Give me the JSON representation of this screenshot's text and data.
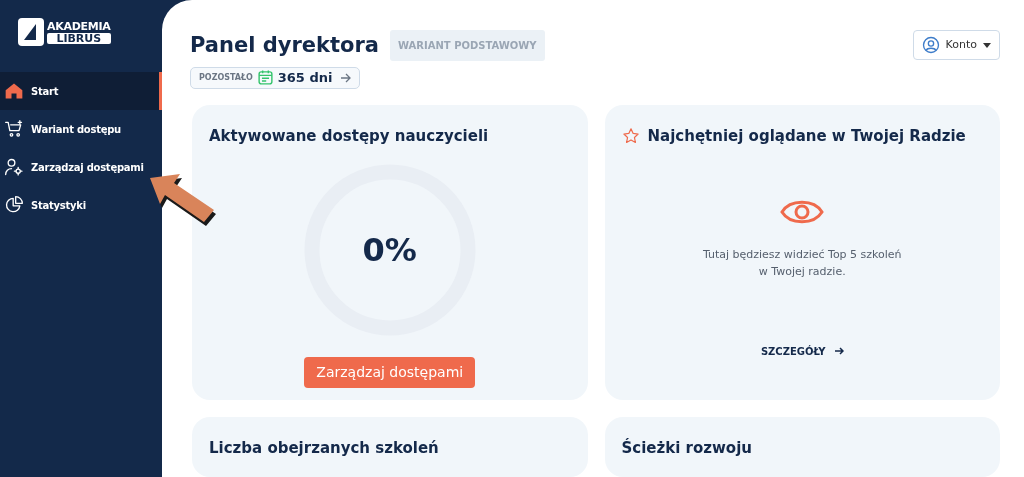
{
  "logo": {
    "line_1": "AKADEMIA",
    "line_2": "LIBRUS"
  },
  "sidebar": {
    "items": [
      {
        "label": "Start",
        "selected": true
      },
      {
        "label": "Wariant dostępu",
        "selected": false
      },
      {
        "label": "Zarządzaj dostępami",
        "selected": false
      },
      {
        "label": "Statystyki",
        "selected": false
      }
    ]
  },
  "header": {
    "title": "Panel dyrektora",
    "badge": "WARIANT PODSTAWOWY",
    "account_button": "Konto"
  },
  "remaining": {
    "label": "POZOSTAŁO",
    "value": "365 dni"
  },
  "cards": [
    {
      "kind": "gauge",
      "title": "Aktywowane dostępy nauczycieli",
      "value": "0%",
      "button": "Zarządzaj dostępami"
    },
    {
      "kind": "empty",
      "title": "Najchętniej oglądane w Twojej Radzie",
      "message": "Tutaj będziesz widzieć Top 5 szkoleń w Twojej radzie.",
      "link": "SZCZEGÓŁY"
    },
    {
      "kind": "plain",
      "title": "Liczba obejrzanych szkoleń"
    },
    {
      "kind": "plain",
      "title": "Ścieżki rozwoju"
    }
  ]
}
